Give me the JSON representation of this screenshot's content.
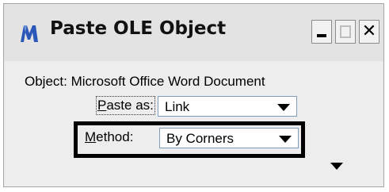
{
  "window": {
    "title": "Paste OLE Object",
    "app_icon": "microstation-icon",
    "controls": {
      "minimize": "minimize-icon",
      "maximize": "maximize-icon",
      "close": "close-icon",
      "close_glyph": "✕"
    }
  },
  "content": {
    "object_line": "Object: Microsoft Office Word Document",
    "paste_as": {
      "label_prefix": "",
      "label_underlined": "P",
      "label_rest": "aste as:",
      "value": "Link"
    },
    "method": {
      "label_underlined": "M",
      "label_rest": "ethod:",
      "value": "By Corners"
    },
    "more_options_icon": "triangle-down-icon"
  },
  "colors": {
    "highlight_border": "#000000",
    "window_bg": "#ededed",
    "titlebar_bg": "#e3e3e3"
  }
}
